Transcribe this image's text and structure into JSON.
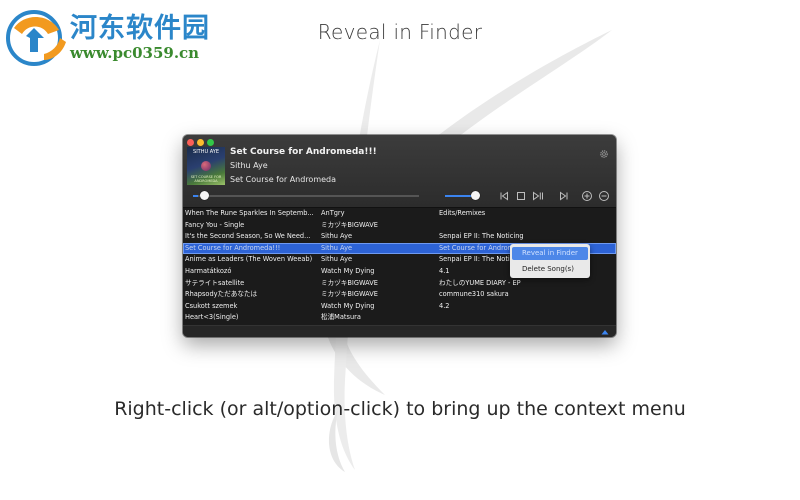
{
  "watermark": {
    "site_name": "河东软件园",
    "site_url": "www.pc0359.cn"
  },
  "heading": "Reveal in Finder",
  "caption": "Right-click (or alt/option-click) to bring up the context menu",
  "player": {
    "artwork": {
      "artist_text": "SITHU AYE",
      "subtitle": "SET COURSE FOR ANDROMEDA"
    },
    "now_playing": {
      "title": "Set Course for Andromeda!!!",
      "artist": "Sithu Aye",
      "album": "Set Course for Andromeda"
    },
    "seek_progress": 0.02,
    "volume_level": 1.0,
    "icons": [
      "gear-icon",
      "previous-icon",
      "stop-icon",
      "play-pause-icon",
      "next-icon",
      "add-icon",
      "remove-icon",
      "collapse-arrow-icon"
    ],
    "accent_color": "#3b84f0",
    "selection_color": "#2d63d6"
  },
  "tracks": [
    {
      "title": "When The Rune Sparkles In Septemb...",
      "artist": "AnTgry",
      "album": "Edits/Remixes"
    },
    {
      "title": "Fancy You - Single",
      "artist": "ミカヅキBIGWAVE",
      "album": ""
    },
    {
      "title": "It's the Second Season, So We Need...",
      "artist": "Sithu Aye",
      "album": "Senpai EP II: The Noticing"
    },
    {
      "title": "Set Course for Andromeda!!!",
      "artist": "Sithu Aye",
      "album": "Set Course for Andromeda",
      "selected": true
    },
    {
      "title": "Anime as Leaders (The Woven Weeab)",
      "artist": "Sithu Aye",
      "album": "Senpai EP II: The Notic"
    },
    {
      "title": "Harmatátkozó",
      "artist": "Watch My Dying",
      "album": "4.1"
    },
    {
      "title": "サテライトsatellite",
      "artist": "ミカヅキBIGWAVE",
      "album": "わたしのYUME DIARY - EP"
    },
    {
      "title": "Rhapsodyただあなたは",
      "artist": "ミカヅキBIGWAVE",
      "album": "commune310 sakura"
    },
    {
      "title": "Csukott szemek",
      "artist": "Watch My Dying",
      "album": "4.2"
    },
    {
      "title": "Heart<3(Single)",
      "artist": "松浦Matsura",
      "album": ""
    }
  ],
  "context_menu": {
    "items": [
      "Reveal in Finder",
      "Delete Song(s)"
    ],
    "highlighted": "Reveal in Finder"
  }
}
